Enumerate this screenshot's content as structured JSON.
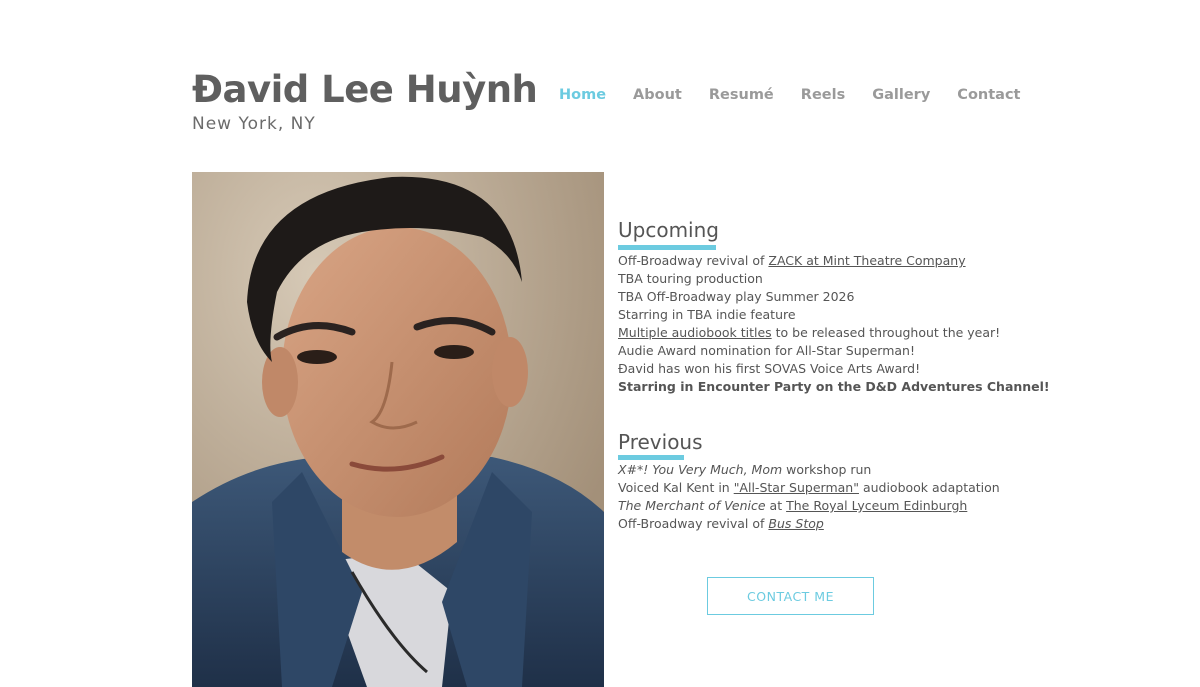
{
  "header": {
    "name": "Đavid Lee Huỳnh",
    "location": "New York, NY"
  },
  "nav": {
    "items": [
      "Home",
      "About",
      "Resumé",
      "Reels",
      "Gallery",
      "Contact"
    ],
    "active": "Home",
    "active_color": "#6ccbe0",
    "inactive_color": "#9a9a9a"
  },
  "upcoming": {
    "heading": "Upcoming",
    "lines": [
      {
        "prefix": "Off-Broadway revival of ",
        "link": "ZACK at Mint Theatre Company"
      },
      {
        "text": "TBA touring production"
      },
      {
        "text": "TBA Off-Broadway play Summer 2026"
      },
      {
        "text": "Starring in TBA indie feature"
      },
      {
        "link": "Multiple audiobook titles",
        "suffix": " to be released throughout the year!"
      },
      {
        "text": "Audie Award nomination for All-Star Superman!"
      },
      {
        "text": "Đavid has won his first SOVAS Voice Arts Award!"
      },
      {
        "text": "Starring in Encounter Party on the D&D Adventures Channel!"
      }
    ]
  },
  "previous": {
    "heading": "Previous",
    "lines": [
      {
        "italic": "X#*! You Very Much, Mom",
        "suffix": " workshop run"
      },
      {
        "prefix": "Voiced Kal Kent in ",
        "link": "\"All-Star Superman\"",
        "suffix": " audiobook adaptation"
      },
      {
        "italic": "The Merchant of Venice",
        "mid": " at ",
        "link": "The Royal Lyceum Edinburgh"
      },
      {
        "prefix": "Off-Broadway revival of ",
        "link": "Bus Stop"
      }
    ]
  },
  "cta": {
    "label": "CONTACT ME"
  },
  "colors": {
    "accent": "#6ccbe0",
    "text": "#555555",
    "title": "#5f5f5f"
  }
}
